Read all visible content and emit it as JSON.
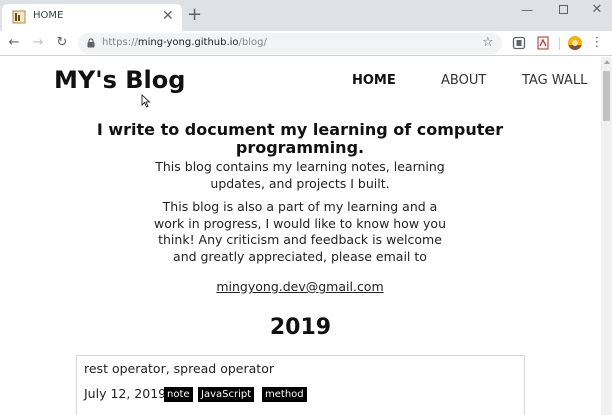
{
  "browser": {
    "tab_title": "HOME",
    "url_scheme": "https://",
    "url_host": "ming-yong.github.io",
    "url_path": "/blog/",
    "icons": [
      "favicon-icon",
      "close-icon",
      "new-tab-icon",
      "back-icon",
      "forward-icon",
      "reload-icon",
      "lock-icon",
      "star-icon",
      "extension-icon",
      "pdf-icon",
      "profile-icon",
      "menu-icon",
      "minimize-icon",
      "maximize-icon",
      "window-close-icon"
    ]
  },
  "site": {
    "title": "MY's Blog",
    "nav": {
      "home": "HOME",
      "about": "ABOUT",
      "tag_wall": "TAG WALL"
    }
  },
  "intro": {
    "headline": "I write to document my learning of computer programming.",
    "para1": "This blog contains my learning notes, learning updates, and projects I built.",
    "para2": "This blog is also a part of my learning and a work in progress, I would like to know how you think! Any criticism and feedback is welcome and greatly appreciated, please email to",
    "email": "mingyong.dev@gmail.com"
  },
  "archive": {
    "year": "2019",
    "posts": [
      {
        "title": "rest operator, spread operator",
        "date": "July 12, 2019",
        "tags": [
          "note",
          "JavaScript",
          "method"
        ]
      }
    ]
  },
  "colors": {
    "tab_strip": "#dee1e6",
    "omnibox": "#f1f3f4",
    "tag_bg": "#000000",
    "tag_text": "#ffffff"
  }
}
